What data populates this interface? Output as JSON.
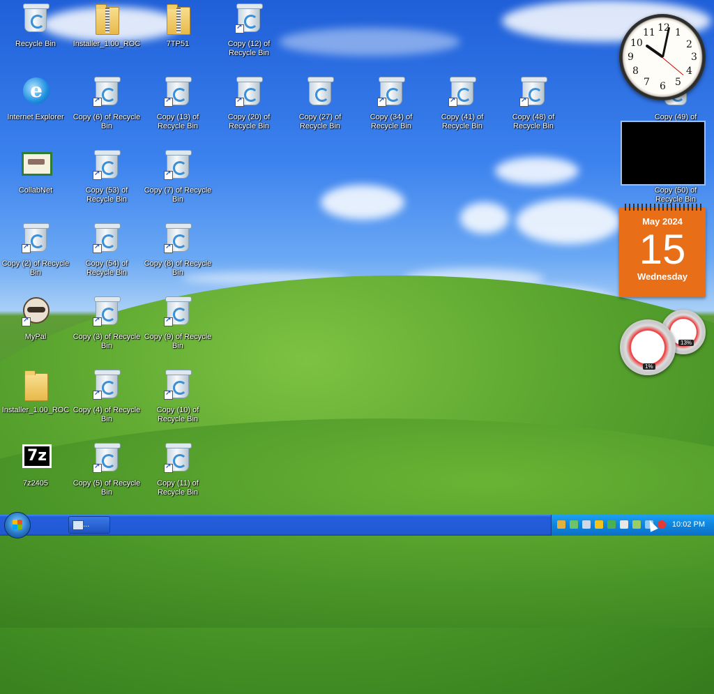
{
  "desktop": {
    "icons": [
      {
        "label": "Recycle Bin"
      },
      {
        "label": "Installer_1.00_ROC"
      },
      {
        "label": "7TP51"
      },
      {
        "label": "Copy (12) of Recycle Bin"
      },
      {
        "label": "Internet Explorer"
      },
      {
        "label": "Copy (6) of Recycle Bin"
      },
      {
        "label": "Copy (13) of Recycle Bin"
      },
      {
        "label": "Copy (20) of Recycle Bin"
      },
      {
        "label": "Copy (27) of Recycle Bin"
      },
      {
        "label": "Copy (34) of Recycle Bin"
      },
      {
        "label": "Copy (41) of Recycle Bin"
      },
      {
        "label": "Copy (48) of Recycle Bin"
      },
      {
        "label": "Copy (49) of"
      },
      {
        "label": "CollabNet"
      },
      {
        "label": "Copy (53) of Recycle Bin"
      },
      {
        "label": "Copy (7) of Recycle Bin"
      },
      {
        "label": "Copy (50) of Recycle Bin"
      },
      {
        "label": "Copy (2) of Recycle Bin"
      },
      {
        "label": "Copy (54) of Recycle Bin"
      },
      {
        "label": "Copy (8) of Recycle Bin"
      },
      {
        "label": "MyPal"
      },
      {
        "label": "Copy (3) of Recycle Bin"
      },
      {
        "label": "Copy (9) of Recycle Bin"
      },
      {
        "label": "Installer_1.00_ROC"
      },
      {
        "label": "Copy (4) of Recycle Bin"
      },
      {
        "label": "Copy (10) of Recycle Bin"
      },
      {
        "label": "7z2405"
      },
      {
        "label": "Copy (5) of Recycle Bin"
      },
      {
        "label": "Copy (11) of Recycle Bin"
      }
    ]
  },
  "gadgets": {
    "clock": {
      "numbers": [
        "12",
        "1",
        "2",
        "3",
        "4",
        "5",
        "6",
        "7",
        "8",
        "9",
        "10",
        "11"
      ]
    },
    "calendar": {
      "month": "May 2024",
      "day": "15",
      "weekday": "Wednesday"
    },
    "cpu_meter": {
      "cpu": "1%",
      "memory": "13%"
    }
  },
  "taskbar": {
    "task_label": "...",
    "clock": "10:02 PM",
    "colors": {
      "bar": "#245ddb",
      "tray": "#0f84dd"
    }
  }
}
